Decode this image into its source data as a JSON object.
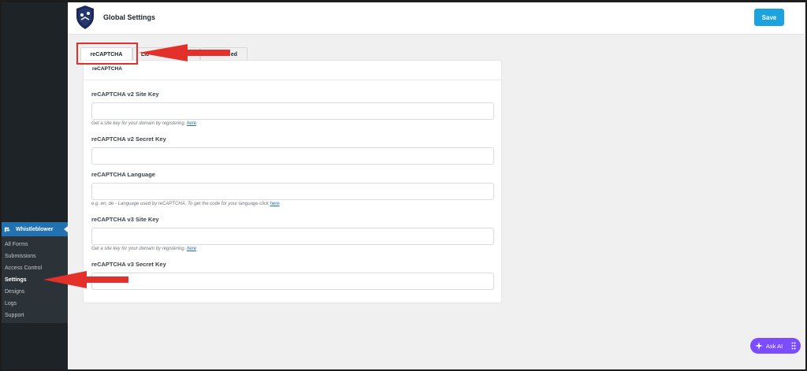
{
  "sidebar": {
    "menu_label": "Whistleblower",
    "items": [
      {
        "label": "All Forms"
      },
      {
        "label": "Submissions"
      },
      {
        "label": "Access Control"
      },
      {
        "label": "Settings"
      },
      {
        "label": "Designs"
      },
      {
        "label": "Logs"
      },
      {
        "label": "Support"
      }
    ],
    "active_item": "Settings"
  },
  "header": {
    "title": "Global Settings",
    "save_label": "Save"
  },
  "tabs": [
    {
      "label": "reCAPTCHA",
      "active": true
    },
    {
      "label": "Lic"
    },
    {
      "label": "ed"
    }
  ],
  "card": {
    "section_tab": "reCAPTCHA",
    "fields": [
      {
        "label": "reCAPTCHA v2 Site Key",
        "value": "",
        "help": "Get a site key for your domain by registering.",
        "help_link": "here"
      },
      {
        "label": "reCAPTCHA v2 Secret Key",
        "value": ""
      },
      {
        "label": "reCAPTCHA Language",
        "value": "",
        "help": "e.g. en, de - Language used by reCAPTCHA. To get the code for your language click",
        "help_link": "here"
      },
      {
        "label": "reCAPTCHA v3 Site Key",
        "value": "",
        "help": "Get a site key for your domain by registering.",
        "help_link": "here"
      },
      {
        "label": "reCAPTCHA v3 Secret Key",
        "value": ""
      }
    ]
  },
  "ask_ai": {
    "label": "Ask AI"
  },
  "colors": {
    "accent": "#2271b1",
    "save": "#1ca3df",
    "annotation": "#e3302b",
    "ask_ai": "#7c4dff"
  },
  "icons": [
    "whistleblower-icon",
    "shield-logo-icon",
    "sparkle-icon",
    "drag-dots-icon",
    "arrow-annotation"
  ]
}
